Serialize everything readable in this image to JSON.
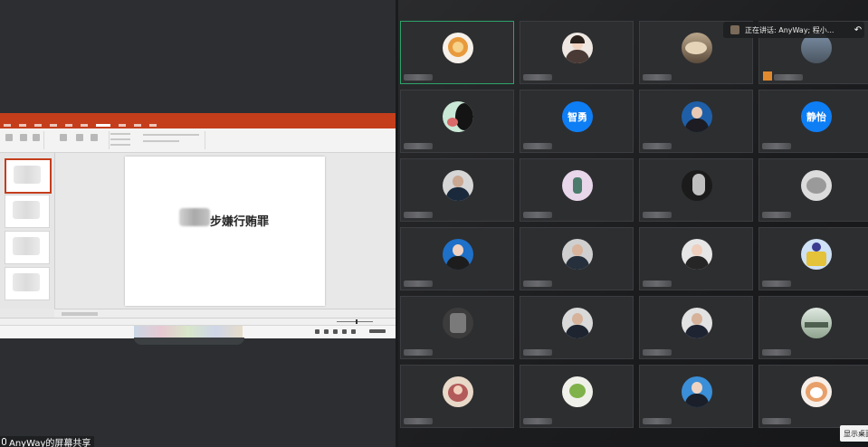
{
  "share": {
    "label": "AnyWay的屏幕共享",
    "slide_title": "步嫌行贿罪"
  },
  "speaker": {
    "text": "正在讲话: AnyWay; 程小...",
    "back_icon": "back-arrow-icon"
  },
  "controls": {
    "show_desktop": "显示桌面"
  },
  "colors": {
    "ppt_accent": "#c43e1c",
    "active_border": "#2ea36b",
    "text_avatar_bg": "#0e7ef5"
  },
  "tiles": [
    {
      "label": "",
      "kind": "photo"
    },
    {
      "label": "",
      "kind": "photo"
    },
    {
      "label": "",
      "kind": "photo"
    },
    {
      "label": "",
      "kind": "photo"
    },
    {
      "label": "",
      "kind": "photo"
    },
    {
      "label": "智勇",
      "kind": "text"
    },
    {
      "label": "",
      "kind": "photo"
    },
    {
      "label": "静怡",
      "kind": "text"
    }
  ]
}
